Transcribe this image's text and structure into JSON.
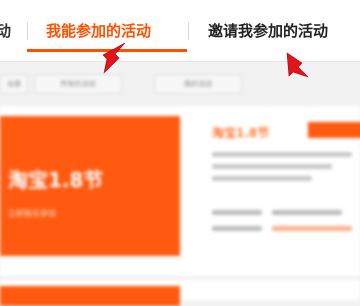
{
  "tabs": {
    "partial_label": "动",
    "active_label": "我能参加的活动",
    "invite_label": "邀请我参加的活动"
  },
  "colors": {
    "accent": "#ff5000",
    "pointer": "#e3141b"
  },
  "filters": [
    "全部",
    "所有的活动",
    "我的活动"
  ],
  "card": {
    "banner_title": "淘宝1.8节",
    "banner_sub": "立即报名参加",
    "title": "淘宝1.8节"
  }
}
